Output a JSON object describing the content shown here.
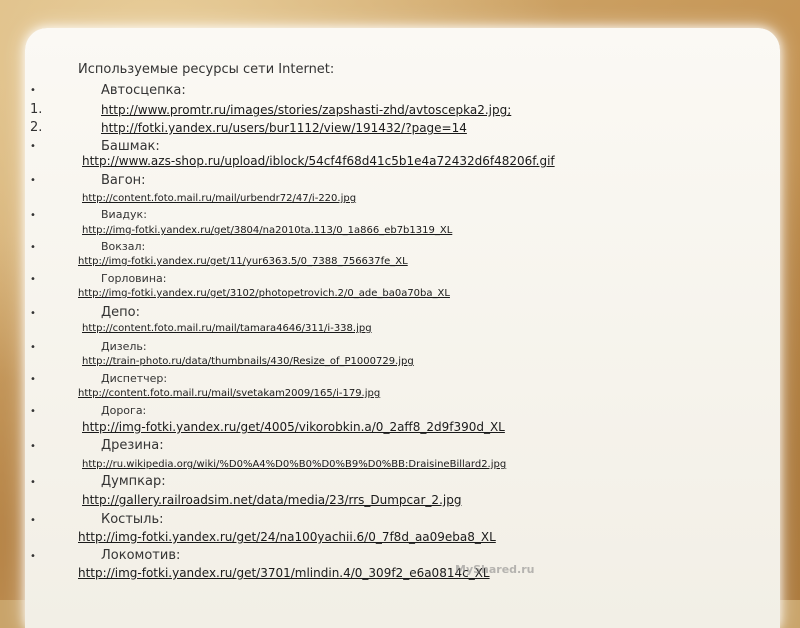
{
  "title": "Используемые ресурсы сети Internet:",
  "bullet": "•",
  "items": [
    {
      "marker": "•",
      "text": "Автосцепка:"
    },
    {
      "marker": "1.",
      "text": "http://www.promtr.ru/images/stories/zapshasti-zhd/avtoscepka2.jpg;"
    },
    {
      "marker": "2.",
      "text": "http://fotki.yandex.ru/users/bur1112/view/191432/?page=14"
    },
    {
      "marker": "•",
      "text": "Башмак:"
    },
    {
      "text": "http://www.azs-shop.ru/upload/iblock/54cf4f68d41c5b1e4a72432d6f48206f.gif"
    },
    {
      "marker": "•",
      "text": "Вагон:"
    },
    {
      "text": "http://content.foto.mail.ru/mail/urbendr72/47/i-220.jpg"
    },
    {
      "marker": "•",
      "text": "Виадук:"
    },
    {
      "text": "http://img-fotki.yandex.ru/get/3804/na2010ta.113/0_1a866_eb7b1319_XL"
    },
    {
      "marker": "•",
      "text": "Вокзал:"
    },
    {
      "text": "http://img-fotki.yandex.ru/get/11/yur6363.5/0_7388_756637fe_XL"
    },
    {
      "marker": "•",
      "text": "Горловина:"
    },
    {
      "text": "http://img-fotki.yandex.ru/get/3102/photopetrovich.2/0_ade_ba0a70ba_XL"
    },
    {
      "marker": "•",
      "text": "Депо:"
    },
    {
      "text": "http://content.foto.mail.ru/mail/tamara4646/311/i-338.jpg"
    },
    {
      "marker": "•",
      "text": "Дизель:"
    },
    {
      "text": "http://train-photo.ru/data/thumbnails/430/Resize_of_P1000729.jpg"
    },
    {
      "marker": "•",
      "text": "Диспетчер:"
    },
    {
      "text": "http://content.foto.mail.ru/mail/svetakam2009/165/i-179.jpg"
    },
    {
      "marker": "•",
      "text": "Дорога:"
    },
    {
      "text": "http://img-fotki.yandex.ru/get/4005/vikorobkin.a/0_2aff8_2d9f390d_XL"
    },
    {
      "marker": "•",
      "text": "Дрезина:"
    },
    {
      "text": "http://ru.wikipedia.org/wiki/%D0%A4%D0%B0%D0%B9%D0%BB:DraisineBillard2.jpg"
    },
    {
      "marker": "•",
      "text": "Думпкар:"
    },
    {
      "text": "http://gallery.railroadsim.net/data/media/23/rrs_Dumpcar_2.jpg"
    },
    {
      "marker": "•",
      "text": "Костыль:"
    },
    {
      "text": "http://img-fotki.yandex.ru/get/24/na100yachii.6/0_7f8d_aa09eba8_XL"
    },
    {
      "marker": "•",
      "text": "Локомотив:"
    },
    {
      "text": "http://img-fotki.yandex.ru/get/3701/mlindin.4/0_309f2_e6a0814c_XL"
    }
  ],
  "watermark": "MyShared.ru"
}
